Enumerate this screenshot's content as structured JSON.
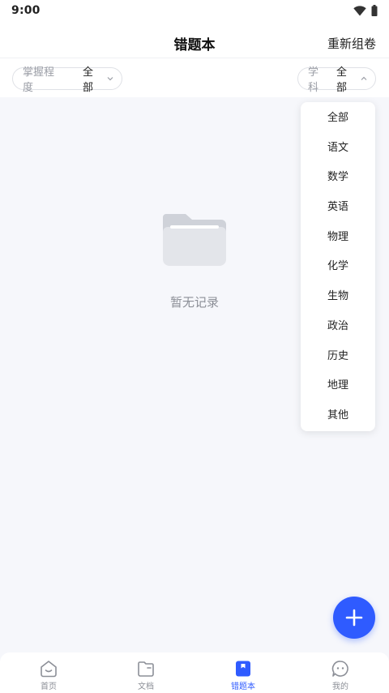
{
  "status_bar": {
    "time": "9:00"
  },
  "nav": {
    "title": "错题本",
    "action_label": "重新组卷"
  },
  "filters": {
    "mastery": {
      "label": "掌握程度",
      "value": "全部"
    },
    "subject": {
      "label": "学科",
      "value": "全部"
    }
  },
  "empty_state": {
    "text": "暂无记录"
  },
  "subject_dropdown": {
    "items": [
      "全部",
      "语文",
      "数学",
      "英语",
      "物理",
      "化学",
      "生物",
      "政治",
      "历史",
      "地理",
      "其他"
    ]
  },
  "tab_bar": {
    "items": [
      {
        "label": "首页",
        "icon": "home-icon"
      },
      {
        "label": "文档",
        "icon": "folder-icon"
      },
      {
        "label": "错题本",
        "icon": "bookmark-icon"
      },
      {
        "label": "我的",
        "icon": "profile-icon"
      }
    ],
    "active": "错题本"
  },
  "colors": {
    "accent": "#2f5bff",
    "background": "#f6f7fb"
  }
}
